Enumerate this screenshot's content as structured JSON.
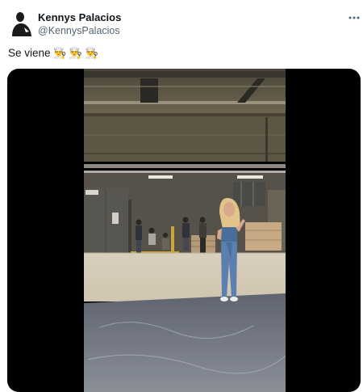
{
  "author": {
    "display_name": "Kennys Palacios",
    "handle": "@KennysPalacios",
    "avatar_icon": "person-silhouette-avatar"
  },
  "tweet": {
    "text": "Se viene",
    "emojis": [
      "👨‍🍳",
      "👨‍🍳",
      "👨‍🍳"
    ]
  },
  "actions": {
    "more_icon": "more-horizontal-icon"
  },
  "media": {
    "type": "video",
    "scene": "industrial-warehouse-stage"
  },
  "colors": {
    "text_primary": "#0f1419",
    "text_secondary": "#536471",
    "media_background": "#000000"
  }
}
